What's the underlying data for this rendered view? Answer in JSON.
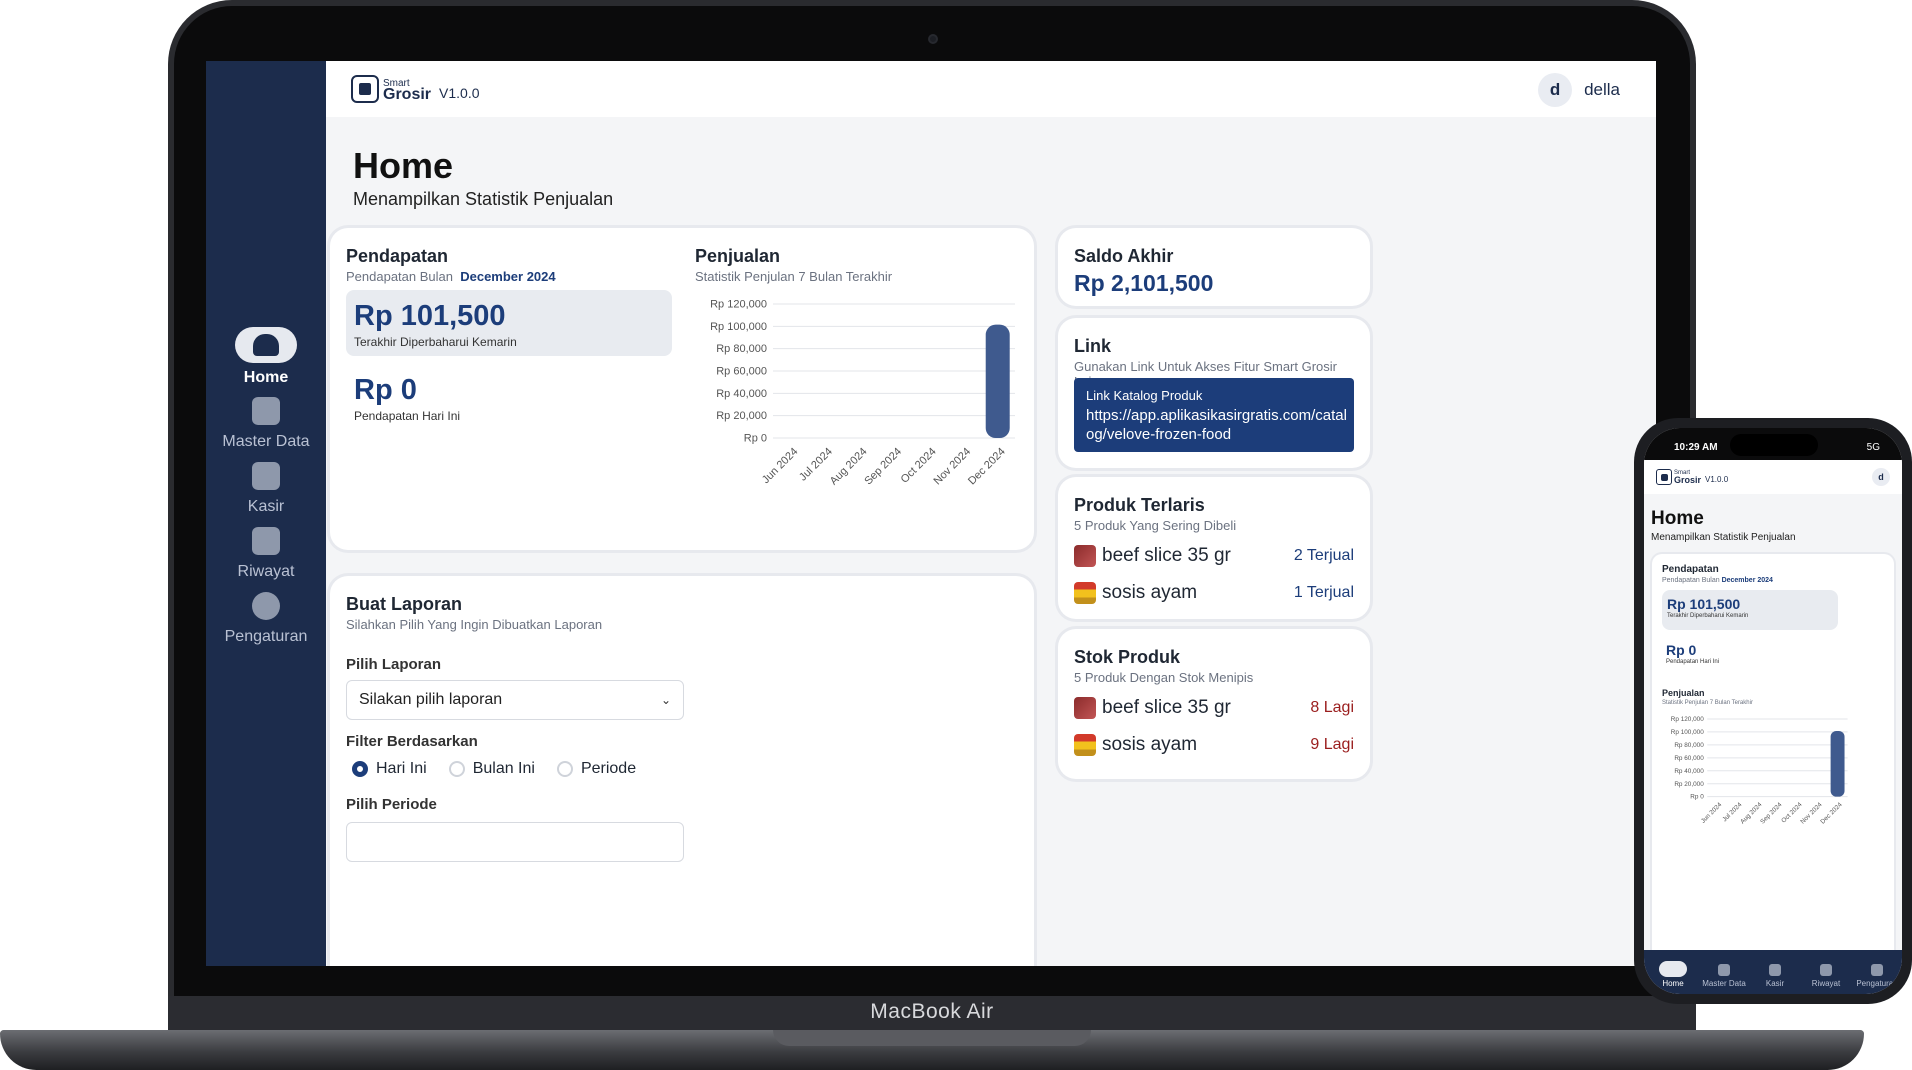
{
  "device": {
    "laptop_label": "MacBook Air"
  },
  "app": {
    "logo_small": "Smart",
    "logo_big": "Grosir",
    "version": "V1.0.0"
  },
  "user": {
    "initial": "d",
    "name": "della"
  },
  "sidebar": {
    "items": [
      {
        "label": "Home",
        "icon": "home-icon",
        "active": true
      },
      {
        "label": "Master Data",
        "icon": "box-icon"
      },
      {
        "label": "Kasir",
        "icon": "calculator-icon"
      },
      {
        "label": "Riwayat",
        "icon": "history-icon"
      },
      {
        "label": "Pengaturan",
        "icon": "gear-icon"
      }
    ]
  },
  "page": {
    "title": "Home",
    "subtitle": "Menampilkan Statistik Penjualan"
  },
  "pendapatan": {
    "title": "Pendapatan",
    "sub_prefix": "Pendapatan Bulan",
    "month": "December 2024",
    "amount_month": "Rp 101,500",
    "updated": "Terakhir Diperbaharui Kemarin",
    "amount_today": "Rp 0",
    "today_label": "Pendapatan Hari Ini"
  },
  "penjualan": {
    "title": "Penjualan",
    "subtitle": "Statistik Penjulan 7 Bulan Terakhir"
  },
  "chart_data": {
    "type": "bar",
    "categories": [
      "Jun 2024",
      "Jul 2024",
      "Aug 2024",
      "Sep 2024",
      "Oct 2024",
      "Nov 2024",
      "Dec 2024"
    ],
    "values": [
      0,
      0,
      0,
      0,
      0,
      0,
      101500
    ],
    "yticks": [
      "Rp 120,000",
      "Rp 100,000",
      "Rp 80,000",
      "Rp 60,000",
      "Rp 40,000",
      "Rp 20,000",
      "Rp 0"
    ],
    "ylim": [
      0,
      120000
    ],
    "grid": true,
    "bar_color": "#3f5a8e"
  },
  "saldo": {
    "title": "Saldo Akhir",
    "amount": "Rp 2,101,500"
  },
  "link": {
    "title": "Link",
    "subtitle": "Gunakan Link Untuk Akses Fitur Smart Grosir Lainnya",
    "box_label": "Link Katalog Produk",
    "url_line1": "https://app.aplikasikasirgratis.com/catal",
    "url_line2": "og/velove-frozen-food"
  },
  "terlaris": {
    "title": "Produk Terlaris",
    "subtitle": "5 Produk Yang Sering Dibeli",
    "items": [
      {
        "name": "beef slice 35 gr",
        "count": "2 Terjual"
      },
      {
        "name": "sosis ayam",
        "count": "1 Terjual"
      }
    ]
  },
  "stok": {
    "title": "Stok Produk",
    "subtitle": "5 Produk Dengan Stok Menipis",
    "items": [
      {
        "name": "beef slice 35 gr",
        "count": "8 Lagi"
      },
      {
        "name": "sosis ayam",
        "count": "9 Lagi"
      }
    ]
  },
  "laporan": {
    "title": "Buat Laporan",
    "subtitle": "Silahkan Pilih Yang Ingin Dibuatkan Laporan",
    "pilih_label": "Pilih Laporan",
    "select_value": "Silakan pilih laporan",
    "filter_label": "Filter Berdasarkan",
    "options": [
      "Hari Ini",
      "Bulan Ini",
      "Periode"
    ],
    "selected": "Hari Ini",
    "periode_label": "Pilih Periode"
  },
  "phone": {
    "time": "10:29 AM",
    "signal": "5G",
    "nav": [
      "Home",
      "Master Data",
      "Kasir",
      "Riwayat",
      "Pengaturan"
    ]
  },
  "colors": {
    "navy": "#1c2c4c",
    "accent": "#1c3d7a",
    "danger": "#9a1d1d"
  }
}
